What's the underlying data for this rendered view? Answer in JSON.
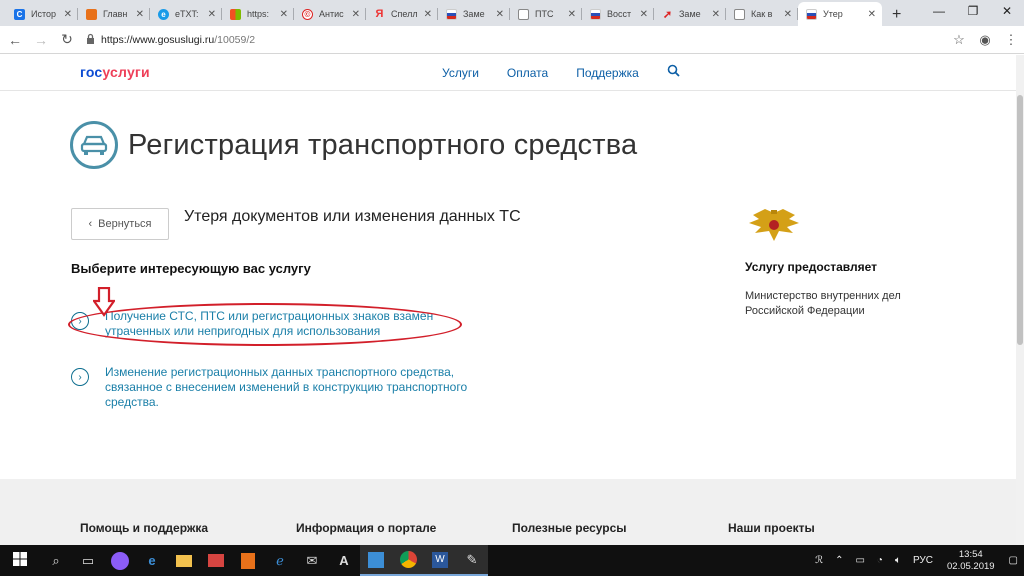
{
  "browser": {
    "tabs": [
      {
        "label": "Истор",
        "icon": "history-icon",
        "color": "#1a73e8"
      },
      {
        "label": "Главн",
        "icon": "orange-site-icon",
        "color": "#e8711a"
      },
      {
        "label": "eTXT:",
        "icon": "etxt-icon",
        "color": "#1a9be8"
      },
      {
        "label": "https:",
        "icon": "windows-icon",
        "color": "#3c8ed6"
      },
      {
        "label": "Антис",
        "icon": "copyright-icon",
        "color": "#d22"
      },
      {
        "label": "Спелл",
        "icon": "yandex-icon",
        "color": "#e33"
      },
      {
        "label": "Заме",
        "icon": "russia-flag-icon",
        "color": "#2a4fb8"
      },
      {
        "label": "ПТС",
        "icon": "doc-icon",
        "color": "#888"
      },
      {
        "label": "Восст",
        "icon": "russia-flag-icon",
        "color": "#2a4fb8"
      },
      {
        "label": "Заме",
        "icon": "red-arrow-icon",
        "color": "#d22"
      },
      {
        "label": "Как в",
        "icon": "doc-icon",
        "color": "#888"
      },
      {
        "label": "Утер",
        "icon": "russia-flag-icon",
        "color": "#2a4fb8",
        "active": true
      }
    ],
    "url_host": "https://www.gosuslugi.ru",
    "url_path": "/10059/2"
  },
  "header": {
    "logo_a": "гос",
    "logo_b": "услуги",
    "nav": [
      "Услуги",
      "Оплата",
      "Поддержка"
    ]
  },
  "page": {
    "title": "Регистрация транспортного средства",
    "back_label": "Вернуться",
    "subtitle": "Утеря документов или изменения данных ТС",
    "choose_heading": "Выберите интересующую вас услугу",
    "services": [
      "Получение СТС, ПТС или регистрационных знаков взамен утраченных или непригодных для использования",
      "Изменение регистрационных данных транспортного средства, связанное с внесением изменений в конструкцию транспортного средства."
    ],
    "provider_heading": "Услугу предоставляет",
    "provider_name": "Министерство внутренних дел Российской Федерации"
  },
  "footer": {
    "columns": [
      "Помощь и поддержка",
      "Информация о портале",
      "Полезные ресурсы",
      "Наши проекты"
    ]
  },
  "taskbar": {
    "lang": "РУС",
    "time": "13:54",
    "date": "02.05.2019"
  }
}
